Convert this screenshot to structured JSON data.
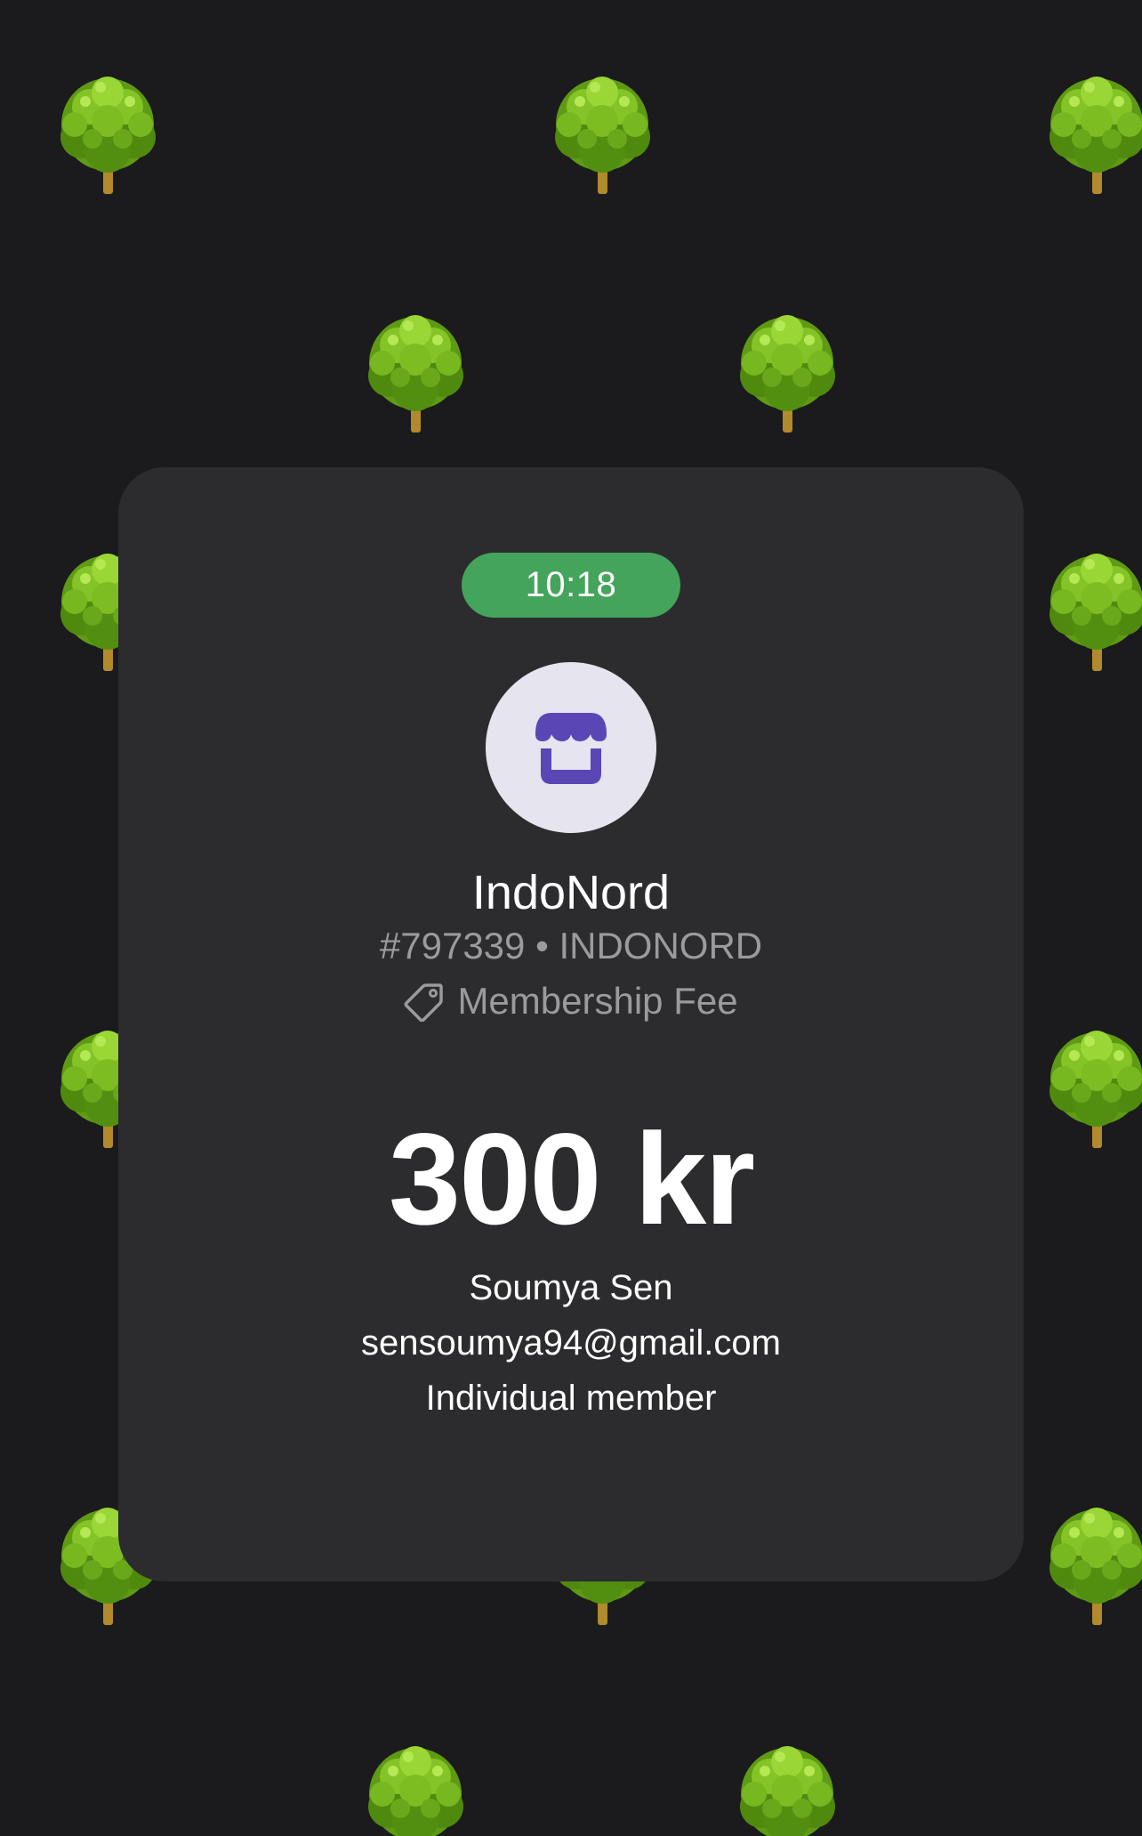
{
  "background": {
    "color": "#1b1b1d",
    "pattern_icon": "deciduous-tree-emoji"
  },
  "card": {
    "background_color": "#2c2c2e",
    "time": "10:18",
    "time_pill_color": "#45a45c",
    "merchant": {
      "icon": "storefront-icon",
      "icon_color": "#5a46b4",
      "name": "IndoNord",
      "subtitle": "#797339 • INDONORD",
      "category_icon": "tag-icon",
      "category": "Membership Fee"
    },
    "amount": "300 kr",
    "payer": {
      "name": "Soumya Sen",
      "email": "sensoumya94@gmail.com",
      "membership_type": "Individual member"
    }
  }
}
